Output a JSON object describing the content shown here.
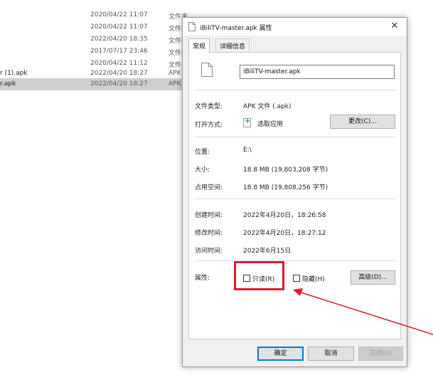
{
  "background_list": {
    "rows": [
      {
        "name": "",
        "date": "2020/04/22 11:07",
        "type": "文件夹",
        "selected": false
      },
      {
        "name": "",
        "date": "2020/04/22 11:07",
        "type": "文件夹",
        "selected": false
      },
      {
        "name": "",
        "date": "2022/04/20 18:35",
        "type": "文件夹",
        "selected": false
      },
      {
        "name": "",
        "date": "2017/07/17 23:46",
        "type": "文件夹",
        "selected": false
      },
      {
        "name": "",
        "date": "2020/04/22 11:12",
        "type": "文件夹",
        "selected": false
      },
      {
        "name": "r (1).apk",
        "date": "2022/04/20 18:27",
        "type": "APK",
        "selected": false
      },
      {
        "name": "r.apk",
        "date": "2022/04/20 18:27",
        "type": "APK",
        "selected": true
      }
    ]
  },
  "dialog": {
    "title": "iBiliTV-master.apk 属性",
    "close_glyph": "✕",
    "tabs": [
      {
        "label": "常规",
        "active": true
      },
      {
        "label": "详细信息",
        "active": false
      }
    ],
    "file_name_value": "iBiliTV-master.apk",
    "file_type_label": "文件类型:",
    "file_type_value": "APK 文件 (.apk)",
    "open_with_label": "打开方式:",
    "open_with_value": "选取应用",
    "change_button": "更改(C)...",
    "location_label": "位置:",
    "location_value": "E:\\",
    "size_label": "大小:",
    "size_value": "18.8 MB (19,803,208 字节)",
    "size_on_disk_label": "占用空间:",
    "size_on_disk_value": "18.8 MB (19,808,256 字节)",
    "created_label": "创建时间:",
    "created_value": "2022年4月20日，18:26:58",
    "modified_label": "修改时间:",
    "modified_value": "2022年4月20日，18:27:12",
    "accessed_label": "访问时间:",
    "accessed_value": "2022年6月15日",
    "attributes_label": "属性:",
    "readonly_label": "只读(R)",
    "hidden_label": "隐藏(H)",
    "advanced_button": "高级(D)...",
    "ok_button": "确定",
    "cancel_button": "取消",
    "apply_button": "应用(A)"
  },
  "annotation": {
    "color": "#e0182d"
  }
}
